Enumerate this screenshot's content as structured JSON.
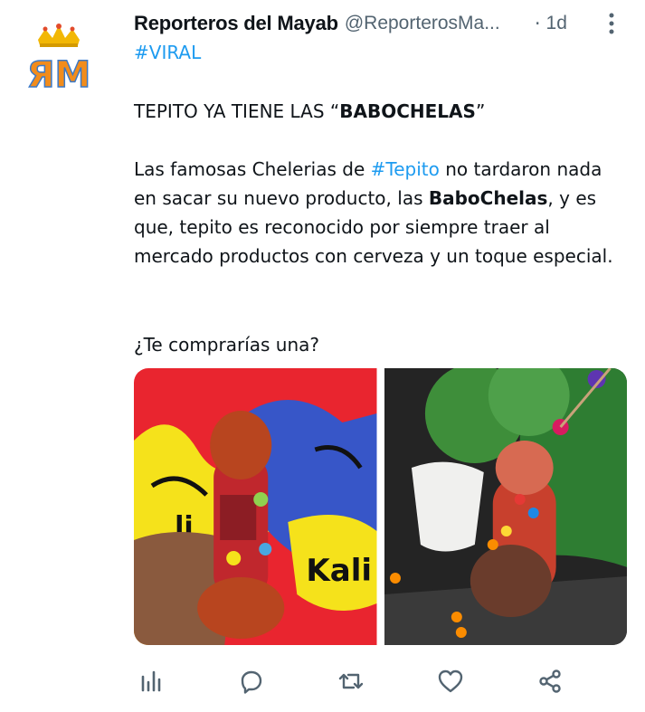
{
  "author": {
    "name": "Reporteros del Mayab",
    "handle": "@ReporterosMa...",
    "separator": "·",
    "time": "1d",
    "avatar_icon": "ym-crown-logo",
    "avatar_text": "ЯM"
  },
  "tweet": {
    "hashtag_viral": "#VIRAL",
    "title_prefix": "TEPITO YA TIENE LAS “",
    "title_bold": "BABOCHELAS",
    "title_suffix": "”",
    "para_1": "Las famosas Chelerias de ",
    "para_hashtag": "#Tepito",
    "para_2": " no tardaron nada en sacar su nuevo producto, las ",
    "para_bold": "BaboChelas",
    "para_3": ", y es que, tepito es reconocido por siempre traer al mercado productos con cerveza y un toque especial.",
    "question": "¿Te comprarías una?"
  },
  "media": {
    "photo_1_sign_text": "Kali",
    "photo_1_sign_text_2": "li"
  },
  "actions": [
    {
      "name": "views-icon"
    },
    {
      "name": "reply-icon"
    },
    {
      "name": "retweet-icon"
    },
    {
      "name": "like-icon"
    },
    {
      "name": "share-icon"
    }
  ],
  "colors": {
    "text": "#0f1419",
    "secondary": "#536471",
    "hashtag": "#1d9bf0"
  }
}
